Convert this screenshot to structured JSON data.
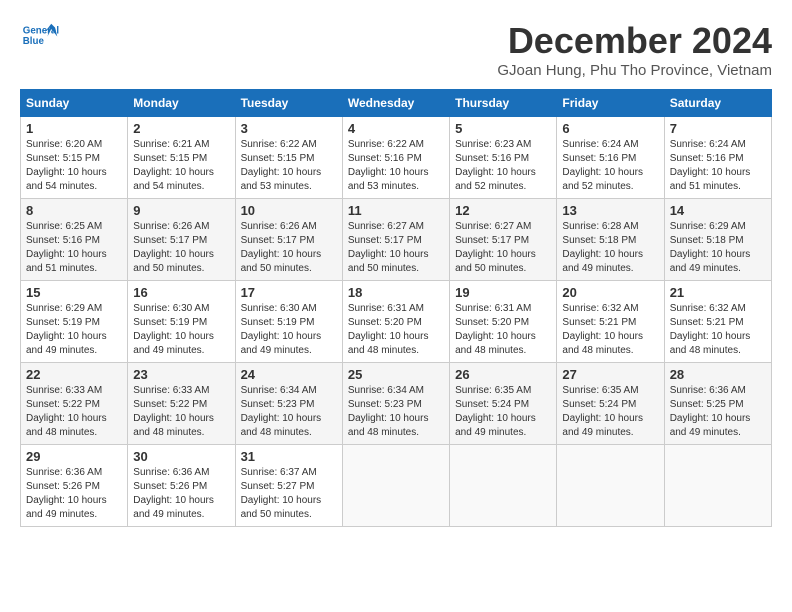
{
  "header": {
    "logo_line1": "General",
    "logo_line2": "Blue",
    "month_title": "December 2024",
    "subtitle": "GJoan Hung, Phu Tho Province, Vietnam"
  },
  "weekdays": [
    "Sunday",
    "Monday",
    "Tuesday",
    "Wednesday",
    "Thursday",
    "Friday",
    "Saturday"
  ],
  "weeks": [
    [
      {
        "day": "1",
        "info": "Sunrise: 6:20 AM\nSunset: 5:15 PM\nDaylight: 10 hours\nand 54 minutes."
      },
      {
        "day": "2",
        "info": "Sunrise: 6:21 AM\nSunset: 5:15 PM\nDaylight: 10 hours\nand 54 minutes."
      },
      {
        "day": "3",
        "info": "Sunrise: 6:22 AM\nSunset: 5:15 PM\nDaylight: 10 hours\nand 53 minutes."
      },
      {
        "day": "4",
        "info": "Sunrise: 6:22 AM\nSunset: 5:16 PM\nDaylight: 10 hours\nand 53 minutes."
      },
      {
        "day": "5",
        "info": "Sunrise: 6:23 AM\nSunset: 5:16 PM\nDaylight: 10 hours\nand 52 minutes."
      },
      {
        "day": "6",
        "info": "Sunrise: 6:24 AM\nSunset: 5:16 PM\nDaylight: 10 hours\nand 52 minutes."
      },
      {
        "day": "7",
        "info": "Sunrise: 6:24 AM\nSunset: 5:16 PM\nDaylight: 10 hours\nand 51 minutes."
      }
    ],
    [
      {
        "day": "8",
        "info": "Sunrise: 6:25 AM\nSunset: 5:16 PM\nDaylight: 10 hours\nand 51 minutes."
      },
      {
        "day": "9",
        "info": "Sunrise: 6:26 AM\nSunset: 5:17 PM\nDaylight: 10 hours\nand 50 minutes."
      },
      {
        "day": "10",
        "info": "Sunrise: 6:26 AM\nSunset: 5:17 PM\nDaylight: 10 hours\nand 50 minutes."
      },
      {
        "day": "11",
        "info": "Sunrise: 6:27 AM\nSunset: 5:17 PM\nDaylight: 10 hours\nand 50 minutes."
      },
      {
        "day": "12",
        "info": "Sunrise: 6:27 AM\nSunset: 5:17 PM\nDaylight: 10 hours\nand 50 minutes."
      },
      {
        "day": "13",
        "info": "Sunrise: 6:28 AM\nSunset: 5:18 PM\nDaylight: 10 hours\nand 49 minutes."
      },
      {
        "day": "14",
        "info": "Sunrise: 6:29 AM\nSunset: 5:18 PM\nDaylight: 10 hours\nand 49 minutes."
      }
    ],
    [
      {
        "day": "15",
        "info": "Sunrise: 6:29 AM\nSunset: 5:19 PM\nDaylight: 10 hours\nand 49 minutes."
      },
      {
        "day": "16",
        "info": "Sunrise: 6:30 AM\nSunset: 5:19 PM\nDaylight: 10 hours\nand 49 minutes."
      },
      {
        "day": "17",
        "info": "Sunrise: 6:30 AM\nSunset: 5:19 PM\nDaylight: 10 hours\nand 49 minutes."
      },
      {
        "day": "18",
        "info": "Sunrise: 6:31 AM\nSunset: 5:20 PM\nDaylight: 10 hours\nand 48 minutes."
      },
      {
        "day": "19",
        "info": "Sunrise: 6:31 AM\nSunset: 5:20 PM\nDaylight: 10 hours\nand 48 minutes."
      },
      {
        "day": "20",
        "info": "Sunrise: 6:32 AM\nSunset: 5:21 PM\nDaylight: 10 hours\nand 48 minutes."
      },
      {
        "day": "21",
        "info": "Sunrise: 6:32 AM\nSunset: 5:21 PM\nDaylight: 10 hours\nand 48 minutes."
      }
    ],
    [
      {
        "day": "22",
        "info": "Sunrise: 6:33 AM\nSunset: 5:22 PM\nDaylight: 10 hours\nand 48 minutes."
      },
      {
        "day": "23",
        "info": "Sunrise: 6:33 AM\nSunset: 5:22 PM\nDaylight: 10 hours\nand 48 minutes."
      },
      {
        "day": "24",
        "info": "Sunrise: 6:34 AM\nSunset: 5:23 PM\nDaylight: 10 hours\nand 48 minutes."
      },
      {
        "day": "25",
        "info": "Sunrise: 6:34 AM\nSunset: 5:23 PM\nDaylight: 10 hours\nand 48 minutes."
      },
      {
        "day": "26",
        "info": "Sunrise: 6:35 AM\nSunset: 5:24 PM\nDaylight: 10 hours\nand 49 minutes."
      },
      {
        "day": "27",
        "info": "Sunrise: 6:35 AM\nSunset: 5:24 PM\nDaylight: 10 hours\nand 49 minutes."
      },
      {
        "day": "28",
        "info": "Sunrise: 6:36 AM\nSunset: 5:25 PM\nDaylight: 10 hours\nand 49 minutes."
      }
    ],
    [
      {
        "day": "29",
        "info": "Sunrise: 6:36 AM\nSunset: 5:26 PM\nDaylight: 10 hours\nand 49 minutes."
      },
      {
        "day": "30",
        "info": "Sunrise: 6:36 AM\nSunset: 5:26 PM\nDaylight: 10 hours\nand 49 minutes."
      },
      {
        "day": "31",
        "info": "Sunrise: 6:37 AM\nSunset: 5:27 PM\nDaylight: 10 hours\nand 50 minutes."
      },
      {
        "day": "",
        "info": ""
      },
      {
        "day": "",
        "info": ""
      },
      {
        "day": "",
        "info": ""
      },
      {
        "day": "",
        "info": ""
      }
    ]
  ]
}
